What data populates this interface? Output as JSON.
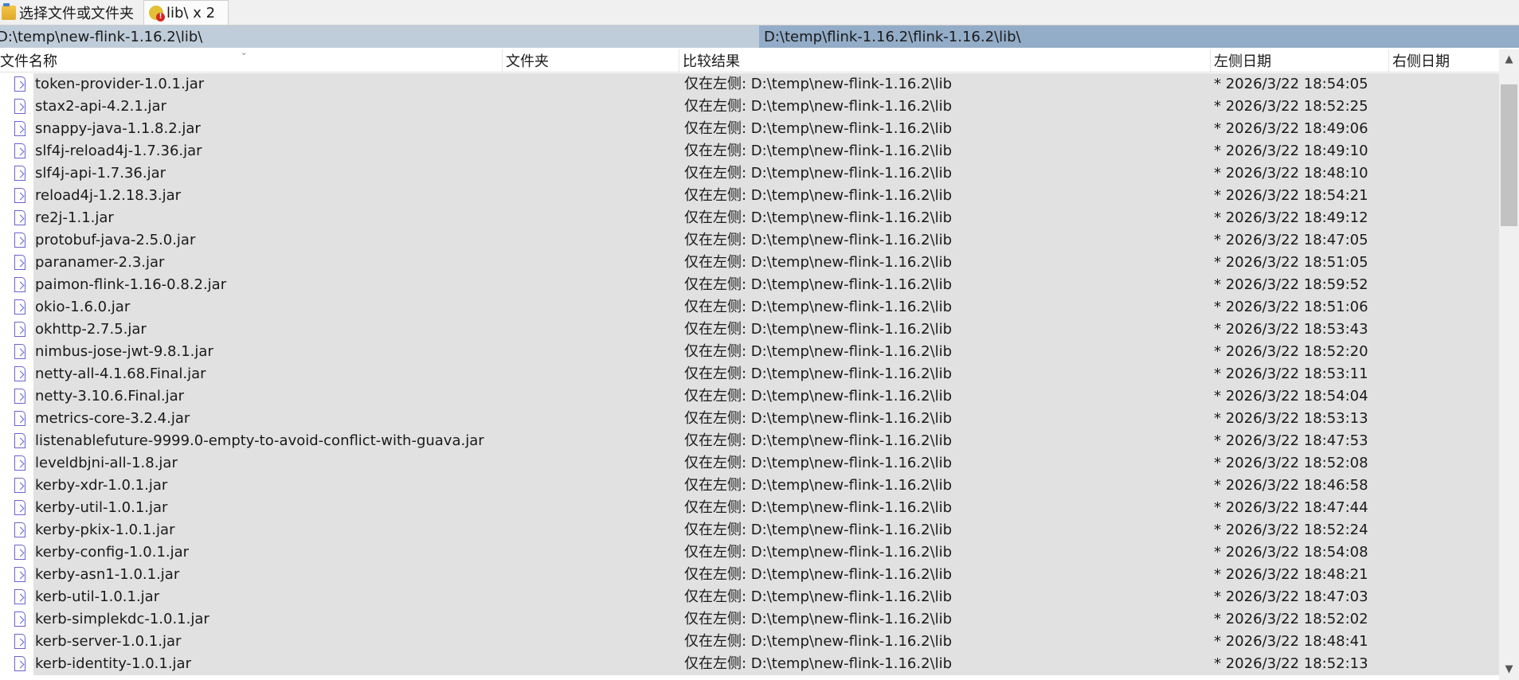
{
  "tabs": [
    {
      "label": "选择文件或文件夹"
    },
    {
      "label": "lib\\ x 2"
    }
  ],
  "paths": {
    "left": "D:\\temp\\new-flink-1.16.2\\lib\\",
    "right": "D:\\temp\\flink-1.16.2\\flink-1.16.2\\lib\\"
  },
  "columns": {
    "name": "文件名称",
    "folder": "文件夹",
    "result": "比较结果",
    "left_date": "左侧日期",
    "right_date": "右侧日期"
  },
  "rows": [
    {
      "name": "token-provider-1.0.1.jar",
      "result": "仅在左侧: D:\\temp\\new-flink-1.16.2\\lib",
      "left_date": "* 2026/3/22 18:54:05"
    },
    {
      "name": "stax2-api-4.2.1.jar",
      "result": "仅在左侧: D:\\temp\\new-flink-1.16.2\\lib",
      "left_date": "* 2026/3/22 18:52:25"
    },
    {
      "name": "snappy-java-1.1.8.2.jar",
      "result": "仅在左侧: D:\\temp\\new-flink-1.16.2\\lib",
      "left_date": "* 2026/3/22 18:49:06"
    },
    {
      "name": "slf4j-reload4j-1.7.36.jar",
      "result": "仅在左侧: D:\\temp\\new-flink-1.16.2\\lib",
      "left_date": "* 2026/3/22 18:49:10"
    },
    {
      "name": "slf4j-api-1.7.36.jar",
      "result": "仅在左侧: D:\\temp\\new-flink-1.16.2\\lib",
      "left_date": "* 2026/3/22 18:48:10"
    },
    {
      "name": "reload4j-1.2.18.3.jar",
      "result": "仅在左侧: D:\\temp\\new-flink-1.16.2\\lib",
      "left_date": "* 2026/3/22 18:54:21"
    },
    {
      "name": "re2j-1.1.jar",
      "result": "仅在左侧: D:\\temp\\new-flink-1.16.2\\lib",
      "left_date": "* 2026/3/22 18:49:12"
    },
    {
      "name": "protobuf-java-2.5.0.jar",
      "result": "仅在左侧: D:\\temp\\new-flink-1.16.2\\lib",
      "left_date": "* 2026/3/22 18:47:05"
    },
    {
      "name": "paranamer-2.3.jar",
      "result": "仅在左侧: D:\\temp\\new-flink-1.16.2\\lib",
      "left_date": "* 2026/3/22 18:51:05"
    },
    {
      "name": "paimon-flink-1.16-0.8.2.jar",
      "result": "仅在左侧: D:\\temp\\new-flink-1.16.2\\lib",
      "left_date": "* 2026/3/22 18:59:52"
    },
    {
      "name": "okio-1.6.0.jar",
      "result": "仅在左侧: D:\\temp\\new-flink-1.16.2\\lib",
      "left_date": "* 2026/3/22 18:51:06"
    },
    {
      "name": "okhttp-2.7.5.jar",
      "result": "仅在左侧: D:\\temp\\new-flink-1.16.2\\lib",
      "left_date": "* 2026/3/22 18:53:43"
    },
    {
      "name": "nimbus-jose-jwt-9.8.1.jar",
      "result": "仅在左侧: D:\\temp\\new-flink-1.16.2\\lib",
      "left_date": "* 2026/3/22 18:52:20"
    },
    {
      "name": "netty-all-4.1.68.Final.jar",
      "result": "仅在左侧: D:\\temp\\new-flink-1.16.2\\lib",
      "left_date": "* 2026/3/22 18:53:11"
    },
    {
      "name": "netty-3.10.6.Final.jar",
      "result": "仅在左侧: D:\\temp\\new-flink-1.16.2\\lib",
      "left_date": "* 2026/3/22 18:54:04"
    },
    {
      "name": "metrics-core-3.2.4.jar",
      "result": "仅在左侧: D:\\temp\\new-flink-1.16.2\\lib",
      "left_date": "* 2026/3/22 18:53:13"
    },
    {
      "name": "listenablefuture-9999.0-empty-to-avoid-conflict-with-guava.jar",
      "result": "仅在左侧: D:\\temp\\new-flink-1.16.2\\lib",
      "left_date": "* 2026/3/22 18:47:53"
    },
    {
      "name": "leveldbjni-all-1.8.jar",
      "result": "仅在左侧: D:\\temp\\new-flink-1.16.2\\lib",
      "left_date": "* 2026/3/22 18:52:08"
    },
    {
      "name": "kerby-xdr-1.0.1.jar",
      "result": "仅在左侧: D:\\temp\\new-flink-1.16.2\\lib",
      "left_date": "* 2026/3/22 18:46:58"
    },
    {
      "name": "kerby-util-1.0.1.jar",
      "result": "仅在左侧: D:\\temp\\new-flink-1.16.2\\lib",
      "left_date": "* 2026/3/22 18:47:44"
    },
    {
      "name": "kerby-pkix-1.0.1.jar",
      "result": "仅在左侧: D:\\temp\\new-flink-1.16.2\\lib",
      "left_date": "* 2026/3/22 18:52:24"
    },
    {
      "name": "kerby-config-1.0.1.jar",
      "result": "仅在左侧: D:\\temp\\new-flink-1.16.2\\lib",
      "left_date": "* 2026/3/22 18:54:08"
    },
    {
      "name": "kerby-asn1-1.0.1.jar",
      "result": "仅在左侧: D:\\temp\\new-flink-1.16.2\\lib",
      "left_date": "* 2026/3/22 18:48:21"
    },
    {
      "name": "kerb-util-1.0.1.jar",
      "result": "仅在左侧: D:\\temp\\new-flink-1.16.2\\lib",
      "left_date": "* 2026/3/22 18:47:03"
    },
    {
      "name": "kerb-simplekdc-1.0.1.jar",
      "result": "仅在左侧: D:\\temp\\new-flink-1.16.2\\lib",
      "left_date": "* 2026/3/22 18:52:02"
    },
    {
      "name": "kerb-server-1.0.1.jar",
      "result": "仅在左侧: D:\\temp\\new-flink-1.16.2\\lib",
      "left_date": "* 2026/3/22 18:48:41"
    },
    {
      "name": "kerb-identity-1.0.1.jar",
      "result": "仅在左侧: D:\\temp\\new-flink-1.16.2\\lib",
      "left_date": "* 2026/3/22 18:52:13"
    }
  ]
}
